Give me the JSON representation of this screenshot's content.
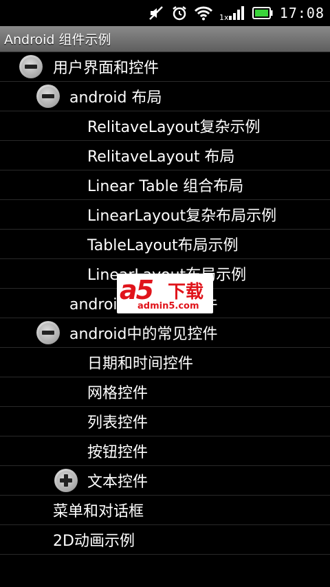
{
  "status_bar": {
    "time": "17:08",
    "icons": [
      "mute-icon",
      "alarm-icon",
      "wifi-icon",
      "signal-icon",
      "battery-icon"
    ],
    "network_type": "1x"
  },
  "title_bar": {
    "title": "Android 组件示例"
  },
  "tree": [
    {
      "label": "用户界面和控件",
      "level": 0,
      "toggle": "collapse"
    },
    {
      "label": "android 布局",
      "level": 1,
      "toggle": "collapse"
    },
    {
      "label": "RelitaveLayout复杂示例",
      "level": 2,
      "toggle": "none"
    },
    {
      "label": "RelitaveLayout 布局",
      "level": 2,
      "toggle": "none"
    },
    {
      "label": "Linear Table 组合布局",
      "level": 2,
      "toggle": "none"
    },
    {
      "label": "LinearLayout复杂布局示例",
      "level": 2,
      "toggle": "none"
    },
    {
      "label": "TableLayout布局示例",
      "level": 2,
      "toggle": "none"
    },
    {
      "label": "LinearLayout布局示例",
      "level": 2,
      "toggle": "none"
    },
    {
      "label": "android中的高级控件",
      "level": 1,
      "toggle": "none"
    },
    {
      "label": "android中的常见控件",
      "level": 1,
      "toggle": "collapse"
    },
    {
      "label": "日期和时间控件",
      "level": 2,
      "toggle": "none"
    },
    {
      "label": "网格控件",
      "level": 2,
      "toggle": "none"
    },
    {
      "label": "列表控件",
      "level": 2,
      "toggle": "none"
    },
    {
      "label": "按钮控件",
      "level": 2,
      "toggle": "none"
    },
    {
      "label": "文本控件",
      "level": 2,
      "toggle": "expand"
    },
    {
      "label": "菜单和对话框",
      "level": 0,
      "toggle": "none"
    },
    {
      "label": "2D动画示例",
      "level": 0,
      "toggle": "none"
    }
  ],
  "watermark": {
    "brand": "a5",
    "text": "下载",
    "url": "admin5.com"
  },
  "colors": {
    "background": "#000000",
    "title_bar": "#6e6e6e",
    "battery": "#3ad43a",
    "watermark_red": "#e0141b"
  }
}
